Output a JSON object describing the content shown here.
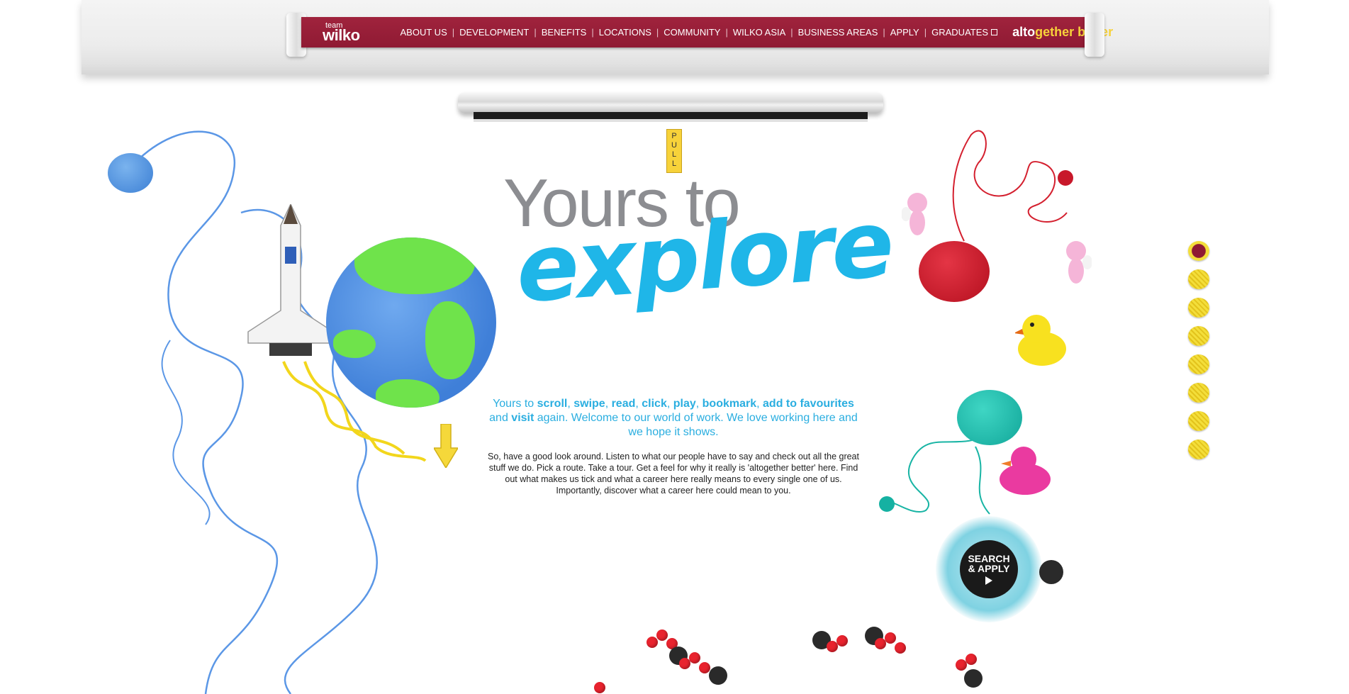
{
  "brand": {
    "logo_small": "team",
    "logo_big": "wilko",
    "tagline_part1": "alto",
    "tagline_part2": "gether",
    "tagline_part3": "better",
    "accent_color": "#8f1a33",
    "highlight_color": "#f7d23a"
  },
  "nav": {
    "items": [
      {
        "label": "ABOUT US"
      },
      {
        "label": "DEVELOPMENT"
      },
      {
        "label": "BENEFITS"
      },
      {
        "label": "LOCATIONS"
      },
      {
        "label": "COMMUNITY"
      },
      {
        "label": "WILKO ASIA"
      },
      {
        "label": "BUSINESS AREAS"
      },
      {
        "label": "APPLY"
      },
      {
        "label": "GRADUATES"
      }
    ],
    "graduates_icon": "external-link-icon"
  },
  "screen": {
    "pull_letters": [
      "P",
      "U",
      "L",
      "L"
    ]
  },
  "headline": {
    "line1": "Yours to",
    "line2": "explore"
  },
  "intro": {
    "t1": "Yours to ",
    "scroll": "scroll",
    "c1": ", ",
    "swipe": "swipe",
    "c2": ", ",
    "read": "read",
    "c3": ", ",
    "click": "click",
    "c4": ", ",
    "play": "play",
    "c5": ", ",
    "bookmark": "bookmark",
    "c6": ", ",
    "favourites": "add to favourites",
    "t2": " and ",
    "visit": "visit",
    "t3": " again. Welcome to our world of work. We love working here and we hope it shows."
  },
  "body_copy": "So, have a good look around. Listen to what our people have to say and check out all the great stuff we do. Pick a route. Take a tour. Get a feel for why it really is 'altogether better' here. Find out what makes us tick and what a career here really means to every single one of us. Importantly, discover what a career here could mean to you.",
  "search_apply": {
    "line1": "SEARCH",
    "line2": "& APPLY"
  },
  "progress_dots": {
    "count": 8,
    "active_index": 0
  }
}
